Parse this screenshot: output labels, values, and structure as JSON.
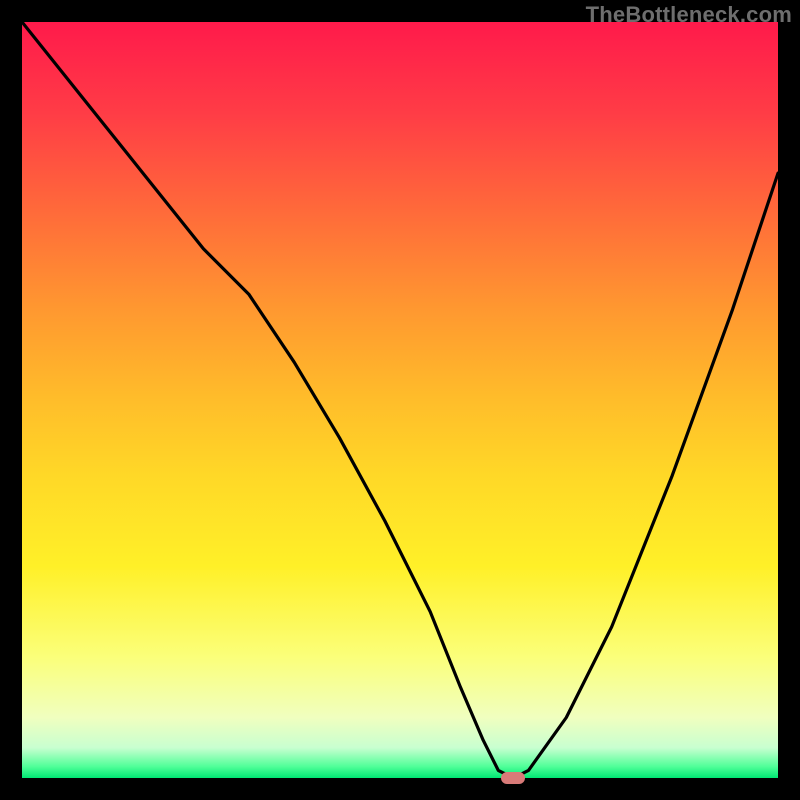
{
  "watermark": "TheBottleneck.com",
  "colors": {
    "frame": "#000000",
    "curve": "#000000",
    "marker": "#d87a78",
    "gradient_top": "#ff1a4b",
    "gradient_bottom": "#00e673"
  },
  "chart_data": {
    "type": "line",
    "title": "",
    "xlabel": "",
    "ylabel": "",
    "xlim": [
      0,
      100
    ],
    "ylim": [
      0,
      100
    ],
    "grid": false,
    "legend": false,
    "series": [
      {
        "name": "bottleneck-curve",
        "x": [
          0,
          8,
          16,
          24,
          30,
          36,
          42,
          48,
          54,
          58,
          61,
          63,
          65,
          67,
          72,
          78,
          86,
          94,
          100
        ],
        "values": [
          100,
          90,
          80,
          70,
          64,
          55,
          45,
          34,
          22,
          12,
          5,
          1,
          0,
          1,
          8,
          20,
          40,
          62,
          80
        ]
      }
    ],
    "marker": {
      "x": 65,
      "y": 0
    }
  }
}
